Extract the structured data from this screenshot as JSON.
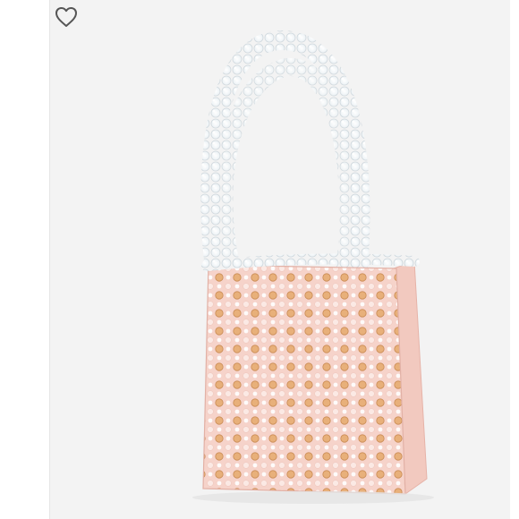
{
  "listing": {
    "like_icon": "heart-outline-icon",
    "product_image": "beaded-handbag-photo"
  },
  "colors": {
    "panel": "#f3f3f3",
    "beads_clear": "#ffffff",
    "bag_pink": "#f3c6bd",
    "bead_gold": "#d4a46a",
    "icon_stroke": "#555555"
  }
}
